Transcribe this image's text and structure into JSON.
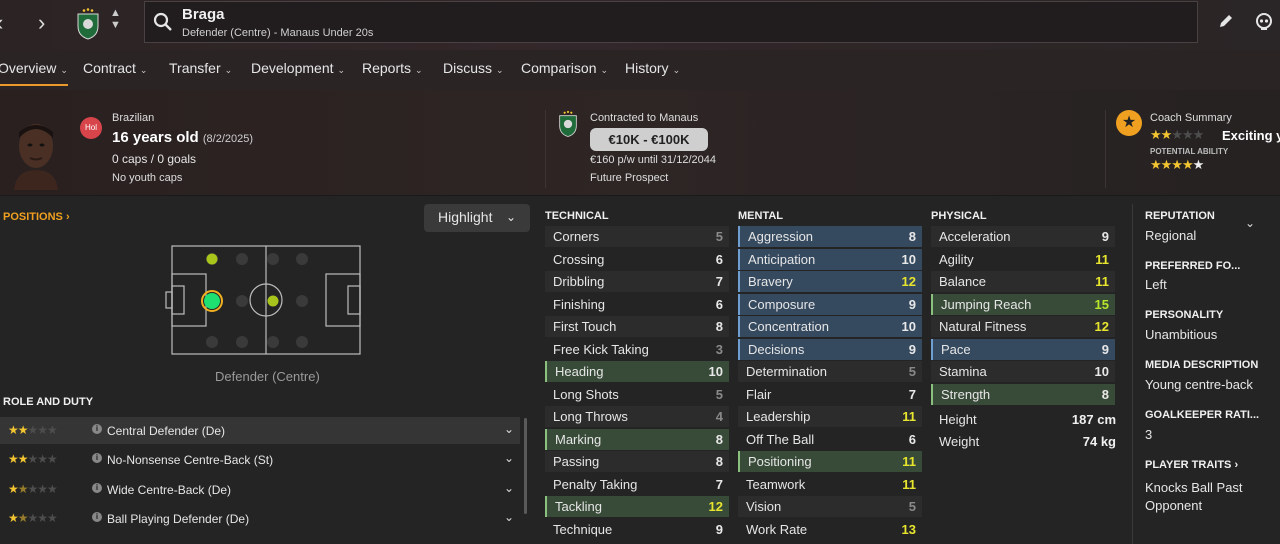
{
  "header": {
    "player_name": "Braga",
    "player_subtitle": "Defender (Centre) - Manaus Under 20s"
  },
  "nav": {
    "tabs": [
      {
        "label": "Overview"
      },
      {
        "label": "Contract"
      },
      {
        "label": "Transfer"
      },
      {
        "label": "Development"
      },
      {
        "label": "Reports"
      },
      {
        "label": "Discuss"
      },
      {
        "label": "Comparison"
      },
      {
        "label": "History"
      }
    ]
  },
  "profile": {
    "nationality_badge": "Hol",
    "nationality": "Brazilian",
    "age": "16 years old",
    "dob": "(8/2/2025)",
    "caps": "0 caps / 0 goals",
    "youth_caps": "No youth caps",
    "contract_label": "Contracted to Manaus",
    "value": "€10K - €100K",
    "wage": "€160 p/w until 31/12/2044",
    "status": "Future Prospect",
    "coach_label": "Coach Summary",
    "coach_text": "Exciting y",
    "potential_label": "POTENTIAL ABILITY",
    "current_ability_stars": 2,
    "potential_ability_stars": 4.5
  },
  "positions": {
    "label": "POSITIONS",
    "highlight_label": "Highlight",
    "caption": "Defender (Centre)"
  },
  "roles": {
    "title": "ROLE AND DUTY",
    "items": [
      {
        "name": "Central Defender (De)",
        "stars": 2
      },
      {
        "name": "No-Nonsense Centre-Back (St)",
        "stars": 2
      },
      {
        "name": "Wide Centre-Back (De)",
        "stars": 1.5
      },
      {
        "name": "Ball Playing Defender (De)",
        "stars": 1.5
      }
    ]
  },
  "attributes": {
    "technical_title": "TECHNICAL",
    "mental_title": "MENTAL",
    "physical_title": "PHYSICAL",
    "technical": [
      {
        "name": "Corners",
        "value": "5"
      },
      {
        "name": "Crossing",
        "value": "6"
      },
      {
        "name": "Dribbling",
        "value": "7"
      },
      {
        "name": "Finishing",
        "value": "6"
      },
      {
        "name": "First Touch",
        "value": "8"
      },
      {
        "name": "Free Kick Taking",
        "value": "3"
      },
      {
        "name": "Heading",
        "value": "10"
      },
      {
        "name": "Long Shots",
        "value": "5"
      },
      {
        "name": "Long Throws",
        "value": "4"
      },
      {
        "name": "Marking",
        "value": "8"
      },
      {
        "name": "Passing",
        "value": "8"
      },
      {
        "name": "Penalty Taking",
        "value": "7"
      },
      {
        "name": "Tackling",
        "value": "12"
      },
      {
        "name": "Technique",
        "value": "9"
      }
    ],
    "mental": [
      {
        "name": "Aggression",
        "value": "8"
      },
      {
        "name": "Anticipation",
        "value": "10"
      },
      {
        "name": "Bravery",
        "value": "12"
      },
      {
        "name": "Composure",
        "value": "9"
      },
      {
        "name": "Concentration",
        "value": "10"
      },
      {
        "name": "Decisions",
        "value": "9"
      },
      {
        "name": "Determination",
        "value": "5"
      },
      {
        "name": "Flair",
        "value": "7"
      },
      {
        "name": "Leadership",
        "value": "11"
      },
      {
        "name": "Off The Ball",
        "value": "6"
      },
      {
        "name": "Positioning",
        "value": "11"
      },
      {
        "name": "Teamwork",
        "value": "11"
      },
      {
        "name": "Vision",
        "value": "5"
      },
      {
        "name": "Work Rate",
        "value": "13"
      }
    ],
    "physical": [
      {
        "name": "Acceleration",
        "value": "9"
      },
      {
        "name": "Agility",
        "value": "11"
      },
      {
        "name": "Balance",
        "value": "11"
      },
      {
        "name": "Jumping Reach",
        "value": "15"
      },
      {
        "name": "Natural Fitness",
        "value": "12"
      },
      {
        "name": "Pace",
        "value": "9"
      },
      {
        "name": "Stamina",
        "value": "10"
      },
      {
        "name": "Strength",
        "value": "8"
      }
    ],
    "height_label": "Height",
    "height": "187 cm",
    "weight_label": "Weight",
    "weight": "74 kg"
  },
  "sidebar": {
    "reputation_label": "REPUTATION",
    "reputation": "Regional",
    "foot_label": "PREFERRED FO...",
    "foot": "Left",
    "personality_label": "PERSONALITY",
    "personality": "Unambitious",
    "media_label": "MEDIA DESCRIPTION",
    "media": "Young centre-back",
    "gk_label": "GOALKEEPER RATI...",
    "gk": "3",
    "traits_label": "PLAYER TRAITS",
    "traits_line1": "Knocks Ball Past",
    "traits_line2": "Opponent"
  },
  "colors": {
    "accent": "#e89a2c",
    "highlight_blue": "#35495f",
    "highlight_green": "#384a38",
    "value_yellow": "#e7e52e",
    "value_green": "#b7e62b"
  }
}
